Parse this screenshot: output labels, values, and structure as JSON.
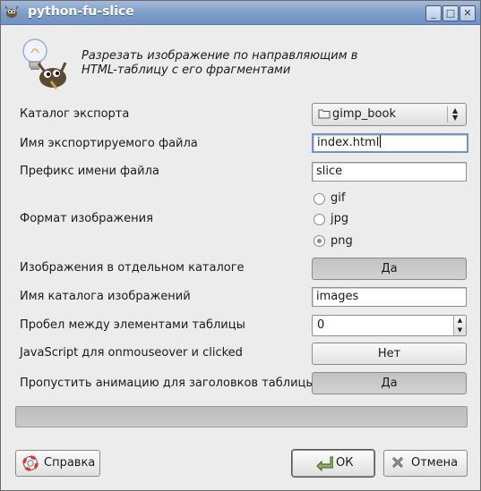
{
  "window": {
    "title": "python-fu-slice",
    "controls": {
      "minimize": "_",
      "maximize": "□",
      "close": "✕"
    }
  },
  "header": {
    "description": "Разрезать изображение по направляющим в HTML-таблицу с его фрагментами",
    "icon": "gimp-wilber-lightbulb-icon"
  },
  "form": {
    "export_dir": {
      "label": "Каталог экспорта",
      "value": "gimp_book"
    },
    "export_filename": {
      "label": "Имя экспортируемого файла",
      "value": "index.html"
    },
    "filename_prefix": {
      "label": "Префикс имени файла",
      "value": "slice"
    },
    "image_format": {
      "label": "Формат изображения",
      "options": [
        "gif",
        "jpg",
        "png"
      ],
      "selected": "png"
    },
    "separate_dir": {
      "label": "Изображения в отдельном каталоге",
      "value": "Да"
    },
    "image_dir_name": {
      "label": "Имя каталога изображений",
      "value": "images"
    },
    "table_spacing": {
      "label": "Пробел между элементами таблицы",
      "value": "0"
    },
    "javascript": {
      "label": "JavaScript для onmouseover и clicked",
      "value": "Нет"
    },
    "skip_animation": {
      "label": "Пропустить анимацию для заголовков таблицы",
      "value": "Да"
    }
  },
  "progress": {
    "fraction": 0
  },
  "buttons": {
    "help": "Справка",
    "ok": "ОК",
    "cancel": "Отмена"
  },
  "colors": {
    "titlebar": "#7d9cc8",
    "dialog_bg": "#ececec",
    "focus": "#7592c4"
  }
}
